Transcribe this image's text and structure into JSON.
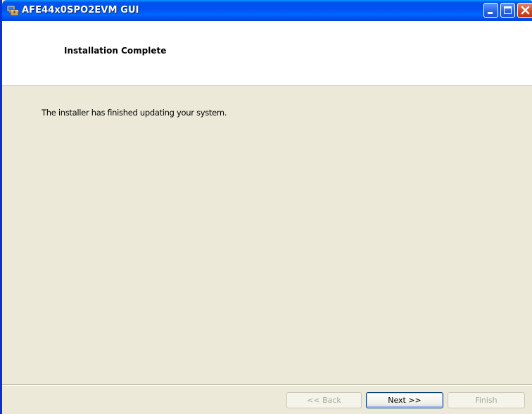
{
  "window": {
    "title": "AFE44x0SPO2EVM GUI"
  },
  "header": {
    "title": "Installation Complete"
  },
  "main": {
    "message": "The installer has finished updating your system."
  },
  "buttons": {
    "back_label": "<< Back",
    "next_label": "Next >>",
    "finish_label": "Finish"
  },
  "icons": {
    "app": "installer-app-icon",
    "minimize": "minimize-icon",
    "maximize": "maximize-icon",
    "close": "close-icon"
  },
  "state": {
    "back_enabled": false,
    "next_enabled": true,
    "finish_enabled": false
  },
  "colors": {
    "titlebar": "#0054e3",
    "dialog_background": "#ece9d8",
    "header_background": "#ffffff",
    "close_button": "#d2461f"
  }
}
